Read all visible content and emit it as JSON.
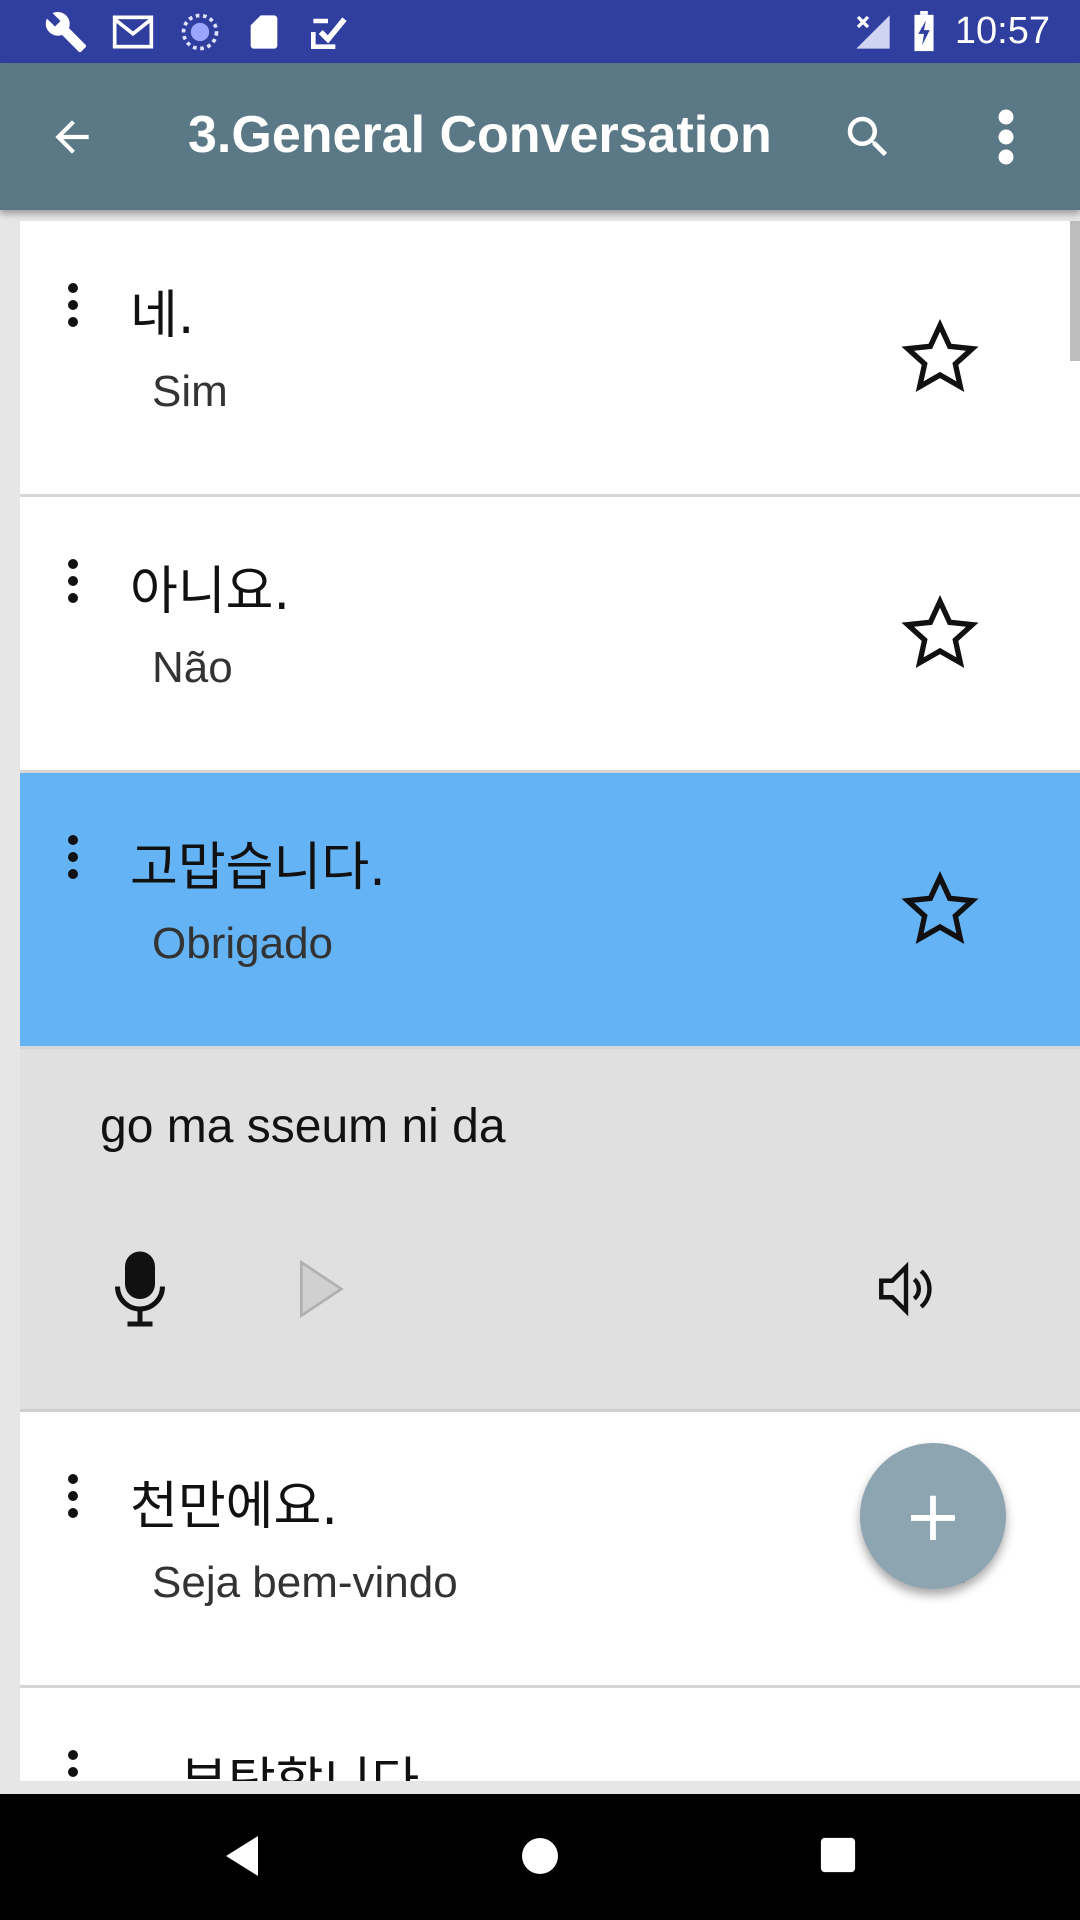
{
  "status_bar": {
    "time": "10:57",
    "icons": [
      "wrench-icon",
      "gmail-icon",
      "sync-icon",
      "sd-card-icon",
      "checkbox-icon",
      "no-signal-icon",
      "battery-charging-icon"
    ]
  },
  "app_bar": {
    "title": "3.General Conversation",
    "icons": [
      "back-arrow-icon",
      "search-icon",
      "overflow-menu-icon"
    ]
  },
  "phrases": [
    {
      "korean": "네.",
      "translation": "Sim",
      "starred": false
    },
    {
      "korean": "아니요.",
      "translation": "Não",
      "starred": false
    },
    {
      "korean": "고맙습니다.",
      "translation": "Obrigado",
      "starred": false,
      "selected": true
    },
    {
      "korean": "천만에요.",
      "translation": "Seja bem-vindo",
      "starred": false
    },
    {
      "korean": "부탁합니다",
      "translation": "",
      "starred": false
    }
  ],
  "detail": {
    "romanization": "go ma sseum ni da",
    "controls": [
      "microphone-icon",
      "play-icon",
      "speaker-icon"
    ]
  },
  "fab": {
    "label": "+"
  },
  "colors": {
    "status_bar": "#303f9f",
    "app_bar": "#5a7885",
    "selected_row": "#64b3f4",
    "fab": "#8ca5b0"
  }
}
